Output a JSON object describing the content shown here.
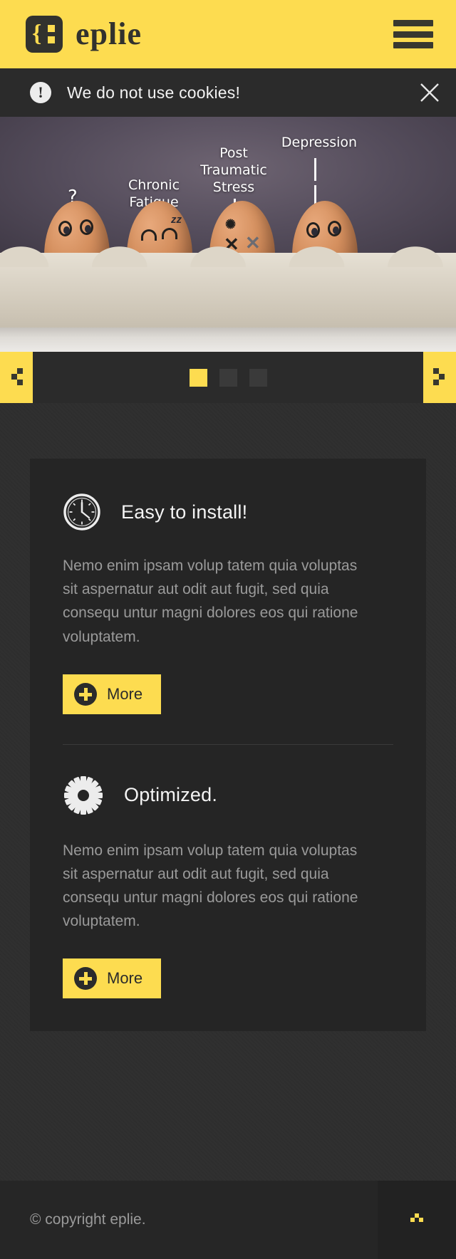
{
  "colors": {
    "brand_yellow": "#fddc50",
    "dark_bg": "#2e2e2e",
    "card_bg": "#252525",
    "header_text": "#32322e",
    "body_text": "#9a9a9a",
    "heading_text": "#f4f4f4",
    "footer_bg": "#262626"
  },
  "header": {
    "brand_name": "eplie",
    "logo_icon": "curly-brace-logo-icon",
    "menu_icon": "hamburger-menu-icon"
  },
  "cookiebar": {
    "icon": "exclamation-circle-icon",
    "message": "We do not use cookies!",
    "close_icon": "close-x-icon"
  },
  "slider": {
    "alt": "Eggs with drawn faces labelled with mental-health conditions",
    "labels": [
      {
        "text": "?",
        "kind": "question-mark"
      },
      {
        "text": "Chronic\nFatigue",
        "kind": "label"
      },
      {
        "text": "Post\nTraumatic\nStress",
        "kind": "label"
      },
      {
        "text": "Depression",
        "kind": "label"
      }
    ],
    "prev_icon": "pixel-arrow-left-icon",
    "next_icon": "pixel-arrow-right-icon",
    "dots": [
      {
        "label": "1",
        "active": true
      },
      {
        "label": "2",
        "active": false
      },
      {
        "label": "3",
        "active": false
      }
    ]
  },
  "main": {
    "features": [
      {
        "icon": "clock-icon",
        "title": "Easy to install!",
        "body": "Nemo enim ipsam volup tatem quia voluptas sit aspernatur aut odit aut fugit, sed quia consequ untur magni dolores eos qui ratione voluptatem.",
        "button_label": "More",
        "button_icon": "plus-circle-icon"
      },
      {
        "icon": "gear-icon",
        "title": "Optimized.",
        "body": "Nemo enim ipsam volup tatem quia voluptas sit aspernatur aut odit aut fugit, sed quia consequ untur magni dolores eos qui ratione voluptatem.",
        "button_label": "More",
        "button_icon": "plus-circle-icon"
      }
    ]
  },
  "footer": {
    "copyright": "© copyright eplie.",
    "totop_icon": "pixel-arrow-up-icon"
  }
}
